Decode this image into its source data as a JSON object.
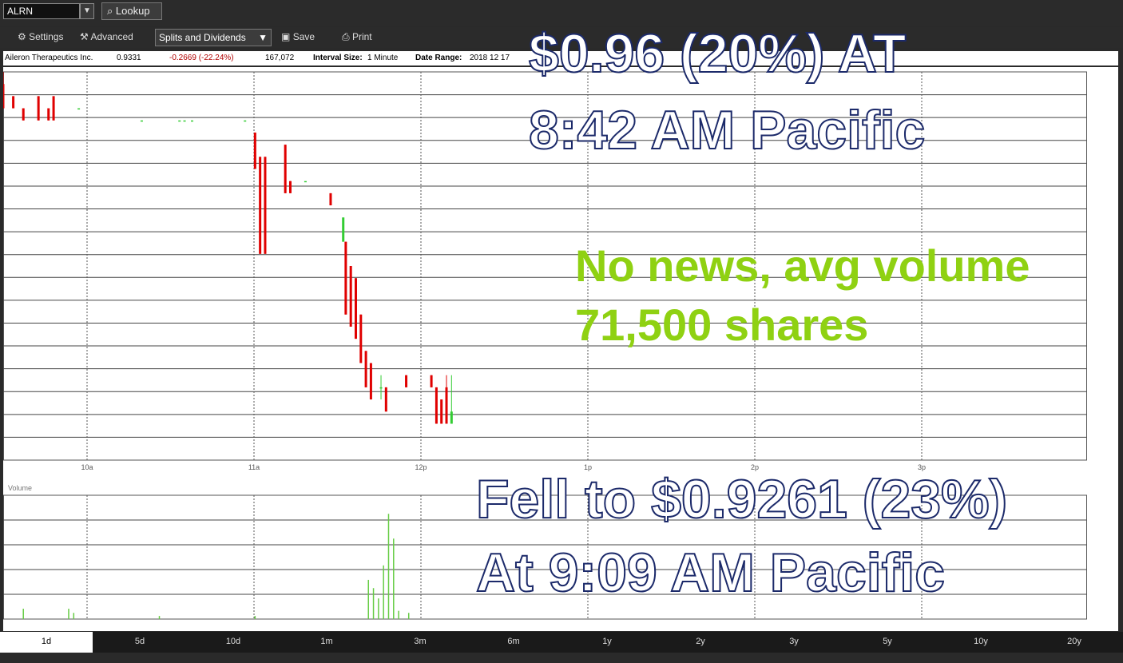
{
  "toolbar": {
    "symbol_value": "ALRN",
    "lookup_label": "Lookup",
    "settings_label": "Settings",
    "advanced_label": "Advanced",
    "splits_label": "Splits and Dividends",
    "save_label": "Save",
    "print_label": "Print"
  },
  "info": {
    "company": "Aileron Therapeutics Inc.",
    "price": "0.9331",
    "change": "-0.2669 (-22.24%)",
    "volume": "167,072",
    "interval_label": "Interval Size:",
    "interval_value": "1 Minute",
    "range_label": "Date Range:",
    "range_value": "2018 12 17"
  },
  "volume_label": "Volume",
  "overlays": {
    "line1": "$0.96 (20%) AT",
    "line2": "8:42 AM Pacific",
    "line3": "No news, avg volume",
    "line4": "71,500 shares",
    "line5": "Fell to $0.9261 (23%)",
    "line6": "At 9:09 AM Pacific"
  },
  "periods": [
    "1d",
    "5d",
    "10d",
    "1m",
    "3m",
    "6m",
    "1y",
    "2y",
    "3y",
    "5y",
    "10y",
    "20y"
  ],
  "active_period": "1d",
  "colors": {
    "down": "#e00000",
    "up": "#33cc33",
    "volume": "#66cc44",
    "overlay_green": "#8fd112"
  },
  "chart_data": {
    "type": "candlestick",
    "title": "",
    "x_ticks": [
      "10a",
      "11a",
      "12p",
      "1p",
      "2p",
      "3p"
    ],
    "y_range": [
      0.9,
      1.22
    ],
    "grid": true,
    "series": [
      {
        "name": "price",
        "values": [
          {
            "x": 0,
            "o": 1.21,
            "h": 1.22,
            "l": 1.19,
            "c": 1.19
          },
          {
            "x": 4,
            "o": 1.2,
            "h": 1.2,
            "l": 1.19,
            "c": 1.19
          },
          {
            "x": 8,
            "o": 1.19,
            "h": 1.19,
            "l": 1.18,
            "c": 1.18
          },
          {
            "x": 14,
            "o": 1.2,
            "h": 1.2,
            "l": 1.18,
            "c": 1.18
          },
          {
            "x": 18,
            "o": 1.19,
            "h": 1.19,
            "l": 1.18,
            "c": 1.18
          },
          {
            "x": 20,
            "o": 1.2,
            "h": 1.2,
            "l": 1.18,
            "c": 1.18
          },
          {
            "x": 30,
            "o": 1.19,
            "h": 1.19,
            "l": 1.19,
            "c": 1.19
          },
          {
            "x": 55,
            "o": 1.18,
            "h": 1.18,
            "l": 1.18,
            "c": 1.18
          },
          {
            "x": 70,
            "o": 1.18,
            "h": 1.18,
            "l": 1.18,
            "c": 1.18
          },
          {
            "x": 72,
            "o": 1.18,
            "h": 1.18,
            "l": 1.18,
            "c": 1.18
          },
          {
            "x": 75,
            "o": 1.18,
            "h": 1.18,
            "l": 1.18,
            "c": 1.18
          },
          {
            "x": 96,
            "o": 1.18,
            "h": 1.18,
            "l": 1.18,
            "c": 1.18
          },
          {
            "x": 100,
            "o": 1.17,
            "h": 1.17,
            "l": 1.14,
            "c": 1.14
          },
          {
            "x": 102,
            "o": 1.15,
            "h": 1.15,
            "l": 1.07,
            "c": 1.07
          },
          {
            "x": 104,
            "o": 1.15,
            "h": 1.15,
            "l": 1.07,
            "c": 1.07
          },
          {
            "x": 112,
            "o": 1.16,
            "h": 1.16,
            "l": 1.12,
            "c": 1.12
          },
          {
            "x": 114,
            "o": 1.13,
            "h": 1.13,
            "l": 1.12,
            "c": 1.12
          },
          {
            "x": 120,
            "o": 1.13,
            "h": 1.13,
            "l": 1.13,
            "c": 1.13
          },
          {
            "x": 130,
            "o": 1.12,
            "h": 1.12,
            "l": 1.11,
            "c": 1.11
          },
          {
            "x": 135,
            "o": 1.08,
            "h": 1.1,
            "l": 1.08,
            "c": 1.1
          },
          {
            "x": 136,
            "o": 1.08,
            "h": 1.08,
            "l": 1.02,
            "c": 1.02
          },
          {
            "x": 138,
            "o": 1.06,
            "h": 1.06,
            "l": 1.01,
            "c": 1.01
          },
          {
            "x": 140,
            "o": 1.05,
            "h": 1.05,
            "l": 1.0,
            "c": 1.0
          },
          {
            "x": 142,
            "o": 1.02,
            "h": 1.02,
            "l": 0.98,
            "c": 0.98
          },
          {
            "x": 144,
            "o": 0.99,
            "h": 0.99,
            "l": 0.96,
            "c": 0.96
          },
          {
            "x": 146,
            "o": 0.98,
            "h": 0.98,
            "l": 0.95,
            "c": 0.95
          },
          {
            "x": 150,
            "o": 0.96,
            "h": 0.97,
            "l": 0.95,
            "c": 0.96
          },
          {
            "x": 152,
            "o": 0.96,
            "h": 0.96,
            "l": 0.94,
            "c": 0.94
          },
          {
            "x": 160,
            "o": 0.97,
            "h": 0.97,
            "l": 0.96,
            "c": 0.96
          },
          {
            "x": 170,
            "o": 0.97,
            "h": 0.97,
            "l": 0.96,
            "c": 0.96
          },
          {
            "x": 172,
            "o": 0.96,
            "h": 0.96,
            "l": 0.93,
            "c": 0.93
          },
          {
            "x": 174,
            "o": 0.95,
            "h": 0.95,
            "l": 0.93,
            "c": 0.93
          },
          {
            "x": 176,
            "o": 0.96,
            "h": 0.97,
            "l": 0.93,
            "c": 0.93
          },
          {
            "x": 178,
            "o": 0.93,
            "h": 0.97,
            "l": 0.93,
            "c": 0.94
          }
        ]
      },
      {
        "name": "volume",
        "values": [
          {
            "x": 8,
            "v": 500
          },
          {
            "x": 26,
            "v": 500
          },
          {
            "x": 28,
            "v": 300
          },
          {
            "x": 62,
            "v": 150
          },
          {
            "x": 100,
            "v": 150
          },
          {
            "x": 145,
            "v": 1900
          },
          {
            "x": 147,
            "v": 1500
          },
          {
            "x": 149,
            "v": 1000
          },
          {
            "x": 151,
            "v": 2600
          },
          {
            "x": 153,
            "v": 5100
          },
          {
            "x": 155,
            "v": 3900
          },
          {
            "x": 157,
            "v": 400
          },
          {
            "x": 161,
            "v": 300
          }
        ]
      }
    ],
    "x_max": 430,
    "volume_range": [
      0,
      6000
    ]
  }
}
